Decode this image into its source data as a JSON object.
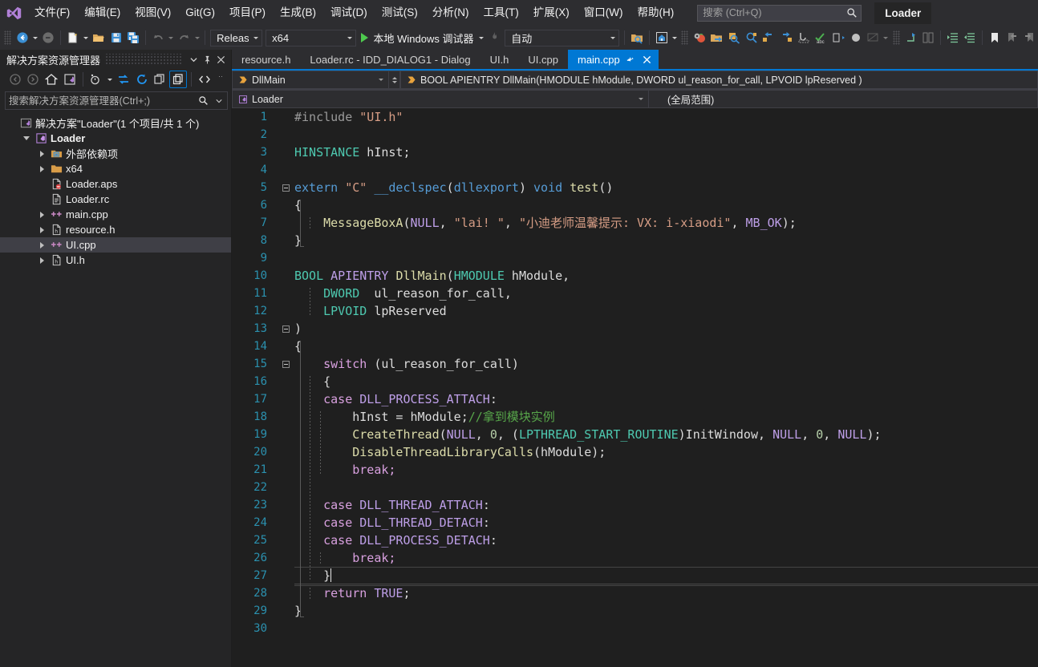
{
  "titlebar": {
    "logo_icon": "visual-studio-logo",
    "menus": [
      "文件(F)",
      "编辑(E)",
      "视图(V)",
      "Git(G)",
      "项目(P)",
      "生成(B)",
      "调试(D)",
      "测试(S)",
      "分析(N)",
      "工具(T)",
      "扩展(X)",
      "窗口(W)",
      "帮助(H)"
    ],
    "search_placeholder": "搜索 (Ctrl+Q)",
    "search_value": "",
    "search_icon": "search-icon",
    "project_chip": "Loader"
  },
  "toolbar": {
    "nav_back_icon": "navigate-back-icon",
    "nav_forward_icon": "navigate-forward-icon",
    "new_item_icon": "new-file-icon",
    "open_icon": "open-folder-icon",
    "save_icon": "save-icon",
    "save_all_icon": "save-all-icon",
    "undo_icon": "undo-icon",
    "redo_icon": "redo-icon",
    "config_value": "Release",
    "platform_value": "x64",
    "run_label": "本地 Windows 调试器",
    "hotreload_icon": "hot-reload-icon",
    "auto_value": "自动",
    "search_folder_icon": "find-in-files-icon",
    "home_icon": "live-share-icon",
    "icons_right": [
      "settings-tomato-icon",
      "folder-arrow-icon",
      "zoom-in-icon",
      "zoom-out-icon",
      "step-left-icon",
      "step-right-icon",
      "hook-icon",
      "spell-check-icon",
      "extract-icon",
      "circle-icon",
      "xaml-icon",
      "indent-icon",
      "compare-icon",
      "increase-indent-icon",
      "decrease-indent-icon",
      "bookmark-icon",
      "prev-bookmark-icon",
      "next-bookmark-icon"
    ]
  },
  "solution_explorer": {
    "title": "解决方案资源管理器",
    "dropdown_icon": "chevron-down-icon",
    "pin_icon": "pin-icon",
    "close_icon": "close-icon",
    "toolbar_icons": [
      "back-icon",
      "forward-icon",
      "home-icon",
      "solution-view-icon",
      "pending-changes-icon",
      "refresh-icon",
      "sync-icon",
      "collapse-all-icon",
      "show-all-files-icon",
      "code-view-icon",
      "overflow-icon"
    ],
    "search_placeholder": "搜索解决方案资源管理器(Ctrl+;)",
    "search_value": "",
    "search_icon": "search-icon",
    "tree": [
      {
        "label": "解决方案\"Loader\"(1 个项目/共 1 个)",
        "icon": "solution-icon",
        "indent": 0,
        "arrow": "none",
        "bold": false,
        "selected": false
      },
      {
        "label": "Loader",
        "icon": "project-icon",
        "indent": 1,
        "arrow": "expanded",
        "bold": true,
        "selected": false
      },
      {
        "label": "外部依赖项",
        "icon": "ext-deps-icon",
        "indent": 2,
        "arrow": "collapsed",
        "bold": false,
        "selected": false
      },
      {
        "label": "x64",
        "icon": "folder-icon",
        "indent": 2,
        "arrow": "collapsed",
        "bold": false,
        "selected": false
      },
      {
        "label": "Loader.aps",
        "icon": "aps-file-icon",
        "indent": 2,
        "arrow": "none",
        "bold": false,
        "selected": false
      },
      {
        "label": "Loader.rc",
        "icon": "rc-file-icon",
        "indent": 2,
        "arrow": "none",
        "bold": false,
        "selected": false
      },
      {
        "label": "main.cpp",
        "icon": "cpp-file-icon",
        "indent": 2,
        "arrow": "collapsed",
        "bold": false,
        "selected": false
      },
      {
        "label": "resource.h",
        "icon": "h-file-icon",
        "indent": 2,
        "arrow": "collapsed",
        "bold": false,
        "selected": false
      },
      {
        "label": "UI.cpp",
        "icon": "cpp-file-icon",
        "indent": 2,
        "arrow": "collapsed",
        "bold": false,
        "selected": true
      },
      {
        "label": "UI.h",
        "icon": "h-file-icon",
        "indent": 2,
        "arrow": "collapsed",
        "bold": false,
        "selected": false
      }
    ]
  },
  "editor": {
    "tabs": [
      {
        "label": "resource.h",
        "active": false
      },
      {
        "label": "Loader.rc - IDD_DIALOG1 - Dialog",
        "active": false
      },
      {
        "label": "UI.h",
        "active": false
      },
      {
        "label": "UI.cpp",
        "active": false
      },
      {
        "label": "main.cpp",
        "active": true,
        "pin_icon": "pin-icon",
        "close_icon": "close-icon"
      }
    ],
    "navbar": {
      "member_scope": "DllMain",
      "member_scope_icon": "method-icon",
      "signature": "BOOL APIENTRY DllMain(HMODULE hModule, DWORD ul_reason_for_call, LPVOID lpReserved )",
      "signature_icon": "method-icon",
      "project_scope": "Loader",
      "project_scope_icon": "project-icon",
      "global_scope": "(全局范围)"
    },
    "code_lines": [
      {
        "n": 1,
        "tokens": [
          {
            "t": "#include ",
            "c": "t-pre"
          },
          {
            "t": "\"UI.h\"",
            "c": "t-str"
          }
        ]
      },
      {
        "n": 2,
        "tokens": []
      },
      {
        "n": 3,
        "tokens": [
          {
            "t": "HINSTANCE",
            "c": "t-type"
          },
          {
            "t": " hInst;",
            "c": "t-id"
          }
        ]
      },
      {
        "n": 4,
        "tokens": []
      },
      {
        "n": 5,
        "tokens": [
          {
            "t": "extern ",
            "c": "t-kw"
          },
          {
            "t": "\"C\"",
            "c": "t-str"
          },
          {
            "t": " __declspec",
            "c": "t-kw"
          },
          {
            "t": "(",
            "c": "t-pun"
          },
          {
            "t": "dllexport",
            "c": "t-kw"
          },
          {
            "t": ") ",
            "c": "t-pun"
          },
          {
            "t": "void ",
            "c": "t-kw"
          },
          {
            "t": "test",
            "c": "t-fn"
          },
          {
            "t": "()",
            "c": "t-pun"
          }
        ]
      },
      {
        "n": 6,
        "tokens": [
          {
            "t": "{",
            "c": "t-pun"
          }
        ]
      },
      {
        "n": 7,
        "tokens": [
          {
            "t": "    MessageBoxA",
            "c": "t-fn"
          },
          {
            "t": "(",
            "c": "t-pun"
          },
          {
            "t": "NULL",
            "c": "t-mac"
          },
          {
            "t": ", ",
            "c": "t-pun"
          },
          {
            "t": "\"lai! \"",
            "c": "t-str"
          },
          {
            "t": ", ",
            "c": "t-pun"
          },
          {
            "t": "\"小迪老师温馨提示: VX: i-xiaodi\"",
            "c": "t-str"
          },
          {
            "t": ", ",
            "c": "t-pun"
          },
          {
            "t": "MB_OK",
            "c": "t-mac"
          },
          {
            "t": ");",
            "c": "t-pun"
          }
        ]
      },
      {
        "n": 8,
        "tokens": [
          {
            "t": "}",
            "c": "t-pun"
          }
        ]
      },
      {
        "n": 9,
        "tokens": []
      },
      {
        "n": 10,
        "tokens": [
          {
            "t": "BOOL ",
            "c": "t-type"
          },
          {
            "t": "APIENTRY ",
            "c": "t-mac"
          },
          {
            "t": "DllMain",
            "c": "t-fn"
          },
          {
            "t": "(",
            "c": "t-pun"
          },
          {
            "t": "HMODULE",
            "c": "t-type"
          },
          {
            "t": " hModule,",
            "c": "t-id"
          }
        ]
      },
      {
        "n": 11,
        "tokens": [
          {
            "t": "    DWORD",
            "c": "t-type"
          },
          {
            "t": "  ul_reason_for_call,",
            "c": "t-id"
          }
        ]
      },
      {
        "n": 12,
        "tokens": [
          {
            "t": "    LPVOID",
            "c": "t-type"
          },
          {
            "t": " lpReserved",
            "c": "t-id"
          }
        ]
      },
      {
        "n": 13,
        "tokens": [
          {
            "t": ")",
            "c": "t-pun"
          }
        ]
      },
      {
        "n": 14,
        "tokens": [
          {
            "t": "{",
            "c": "t-pun"
          }
        ]
      },
      {
        "n": 15,
        "tokens": [
          {
            "t": "    switch",
            "c": "t-ctrl"
          },
          {
            "t": " (ul_reason_for_call)",
            "c": "t-id"
          }
        ]
      },
      {
        "n": 16,
        "tokens": [
          {
            "t": "    {",
            "c": "t-pun"
          }
        ]
      },
      {
        "n": 17,
        "tokens": [
          {
            "t": "    case ",
            "c": "t-ctrl"
          },
          {
            "t": "DLL_PROCESS_ATTACH",
            "c": "t-mac"
          },
          {
            "t": ":",
            "c": "t-pun"
          }
        ]
      },
      {
        "n": 18,
        "tokens": [
          {
            "t": "        hInst = hModule;",
            "c": "t-id"
          },
          {
            "t": "//拿到模块实例",
            "c": "t-com"
          }
        ]
      },
      {
        "n": 19,
        "tokens": [
          {
            "t": "        CreateThread",
            "c": "t-fn"
          },
          {
            "t": "(",
            "c": "t-pun"
          },
          {
            "t": "NULL",
            "c": "t-mac"
          },
          {
            "t": ", ",
            "c": "t-pun"
          },
          {
            "t": "0",
            "c": "t-num"
          },
          {
            "t": ", (",
            "c": "t-pun"
          },
          {
            "t": "LPTHREAD_START_ROUTINE",
            "c": "t-type"
          },
          {
            "t": ")InitWindow, ",
            "c": "t-id"
          },
          {
            "t": "NULL",
            "c": "t-mac"
          },
          {
            "t": ", ",
            "c": "t-pun"
          },
          {
            "t": "0",
            "c": "t-num"
          },
          {
            "t": ", ",
            "c": "t-pun"
          },
          {
            "t": "NULL",
            "c": "t-mac"
          },
          {
            "t": ");",
            "c": "t-pun"
          }
        ]
      },
      {
        "n": 20,
        "tokens": [
          {
            "t": "        DisableThreadLibraryCalls",
            "c": "t-fn"
          },
          {
            "t": "(",
            "c": "t-pun"
          },
          {
            "t": "hModule",
            "c": "t-id"
          },
          {
            "t": ");",
            "c": "t-pun"
          }
        ]
      },
      {
        "n": 21,
        "tokens": [
          {
            "t": "        break;",
            "c": "t-ctrl"
          }
        ]
      },
      {
        "n": 22,
        "tokens": []
      },
      {
        "n": 23,
        "tokens": [
          {
            "t": "    case ",
            "c": "t-ctrl"
          },
          {
            "t": "DLL_THREAD_ATTACH",
            "c": "t-mac"
          },
          {
            "t": ":",
            "c": "t-pun"
          }
        ]
      },
      {
        "n": 24,
        "tokens": [
          {
            "t": "    case ",
            "c": "t-ctrl"
          },
          {
            "t": "DLL_THREAD_DETACH",
            "c": "t-mac"
          },
          {
            "t": ":",
            "c": "t-pun"
          }
        ]
      },
      {
        "n": 25,
        "tokens": [
          {
            "t": "    case ",
            "c": "t-ctrl"
          },
          {
            "t": "DLL_PROCESS_DETACH",
            "c": "t-mac"
          },
          {
            "t": ":",
            "c": "t-pun"
          }
        ]
      },
      {
        "n": 26,
        "tokens": [
          {
            "t": "        break;",
            "c": "t-ctrl"
          }
        ]
      },
      {
        "n": 27,
        "tokens": [
          {
            "t": "    }",
            "c": "t-pun"
          }
        ],
        "current": true
      },
      {
        "n": 28,
        "tokens": [
          {
            "t": "    return ",
            "c": "t-ctrl"
          },
          {
            "t": "TRUE",
            "c": "t-mac"
          },
          {
            "t": ";",
            "c": "t-pun"
          }
        ]
      },
      {
        "n": 29,
        "tokens": [
          {
            "t": "}",
            "c": "t-pun"
          }
        ]
      },
      {
        "n": 30,
        "tokens": []
      }
    ]
  },
  "colors": {
    "accent": "#0078d4",
    "chrome": "#2d2d30",
    "panel": "#252526",
    "editor_bg": "#1f1f1f",
    "line_number": "#2b91af",
    "string": "#d69d85",
    "keyword": "#569cd6",
    "type": "#4ec9b0",
    "function": "#dcdcaa",
    "macro": "#be9fe8",
    "comment": "#57a64a",
    "control": "#d8a0df",
    "number": "#b5cea8"
  }
}
